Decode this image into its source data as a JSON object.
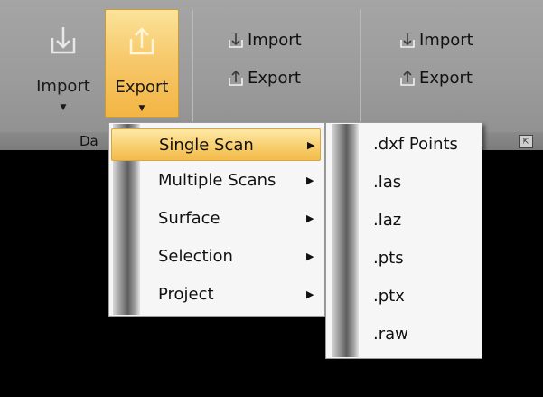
{
  "ribbon": {
    "group1": {
      "label": "Da",
      "import_label": "Import",
      "export_label": "Export",
      "import_icon": "import-arrow-icon",
      "export_icon": "export-arrow-icon"
    },
    "group2": {
      "import_label": "Import",
      "export_label": "Export"
    },
    "group3": {
      "import_label": "Import",
      "export_label": "Export"
    },
    "launcher_icon": "dialog-launcher-icon",
    "accent": "#f7c96c"
  },
  "export_menu": {
    "items": [
      {
        "label": "Single Scan",
        "has_submenu": true,
        "highlighted": true
      },
      {
        "label": "Multiple Scans",
        "has_submenu": true,
        "highlighted": false
      },
      {
        "label": "Surface",
        "has_submenu": true,
        "highlighted": false
      },
      {
        "label": "Selection",
        "has_submenu": true,
        "highlighted": false
      },
      {
        "label": "Project",
        "has_submenu": true,
        "highlighted": false
      }
    ]
  },
  "single_scan_menu": {
    "items": [
      {
        "label": ".dxf Points"
      },
      {
        "label": ".las"
      },
      {
        "label": ".laz"
      },
      {
        "label": ".pts"
      },
      {
        "label": ".ptx"
      },
      {
        "label": ".raw"
      }
    ]
  }
}
